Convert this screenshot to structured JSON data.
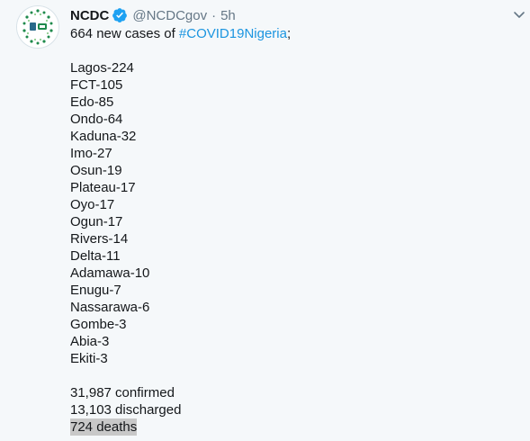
{
  "tweet": {
    "author_name": "NCDC",
    "handle": "@NCDCgov",
    "separator": "·",
    "time": "5h",
    "verified_icon": "verified-badge-icon",
    "menu_icon": "chevron-down-icon",
    "intro_text": "664 new cases of ",
    "hashtag": "#COVID19Nigeria",
    "intro_suffix": ";",
    "states": [
      "Lagos-224",
      "FCT-105",
      "Edo-85",
      "Ondo-64",
      "Kaduna-32",
      "Imo-27",
      "Osun-19",
      "Plateau-17",
      "Oyo-17",
      "Ogun-17",
      "Rivers-14",
      "Delta-11",
      "Adamawa-10",
      "Enugu-7",
      "Nassarawa-6",
      "Gombe-3",
      "Abia-3",
      "Ekiti-3"
    ],
    "confirmed": "31,987 confirmed",
    "discharged": "13,103 discharged",
    "deaths": "724 deaths"
  },
  "colors": {
    "accent": "#1da1f2",
    "hashtag": "#1b95e0",
    "secondary_text": "#657786",
    "background": "#f5f8fa",
    "highlight": "#c8c8c8"
  }
}
